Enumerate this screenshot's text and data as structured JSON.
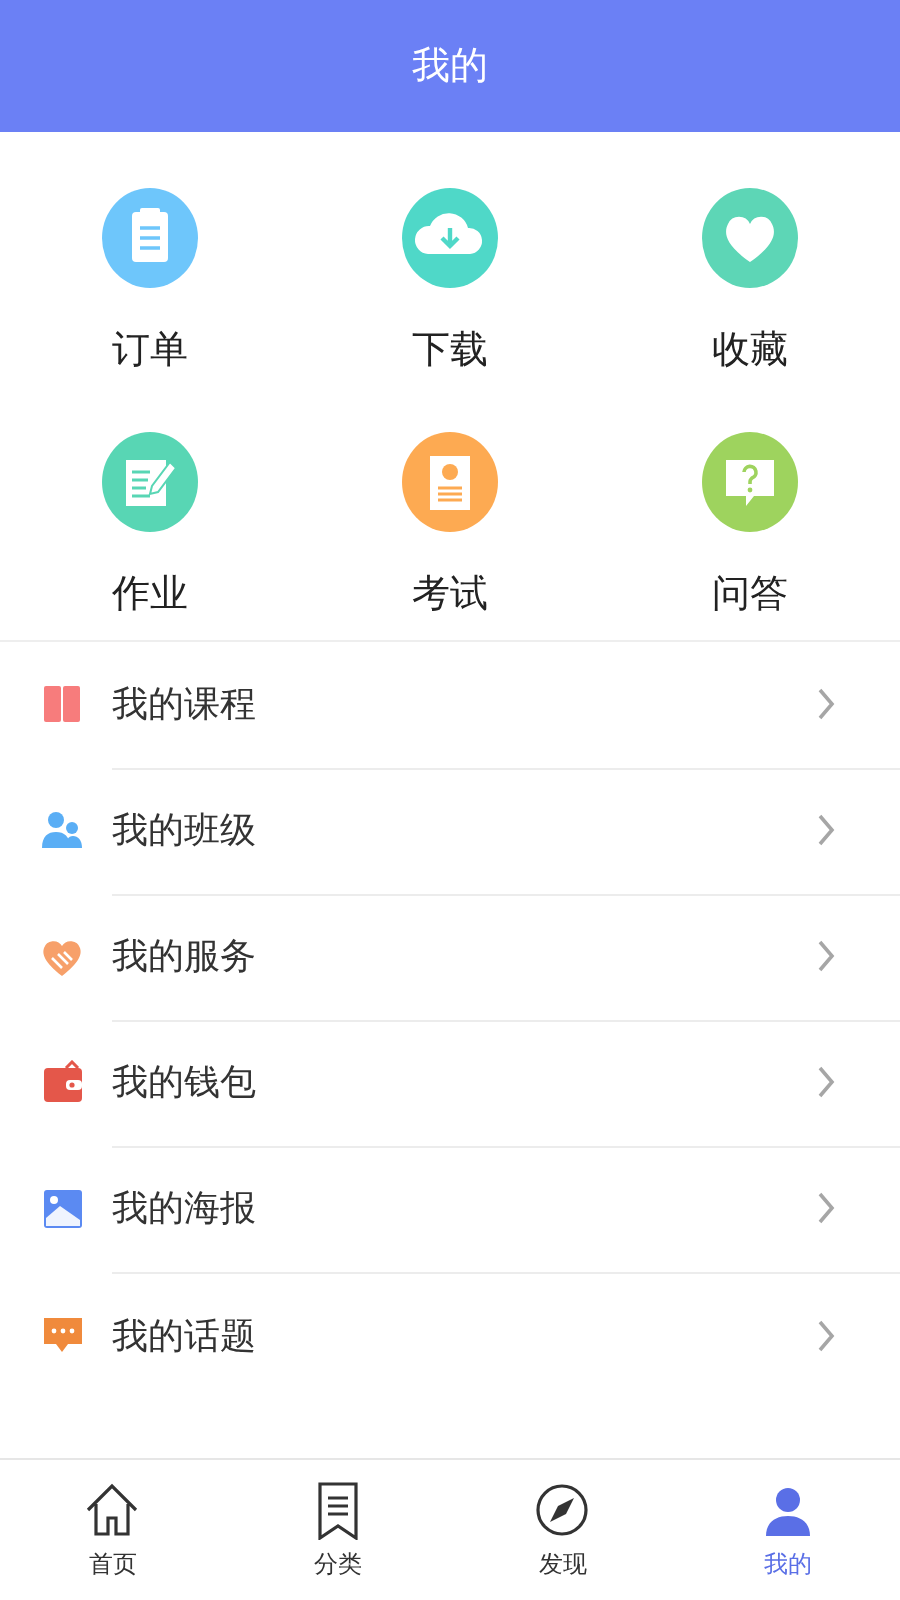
{
  "header": {
    "title": "我的"
  },
  "shortcuts": [
    {
      "label": "订单",
      "color": "#6ec6fb"
    },
    {
      "label": "下载",
      "color": "#4fd8c8"
    },
    {
      "label": "收藏",
      "color": "#5dd6b6"
    },
    {
      "label": "作业",
      "color": "#58d6b4"
    },
    {
      "label": "考试",
      "color": "#fdaa52"
    },
    {
      "label": "问答",
      "color": "#9ed35e"
    }
  ],
  "menu": [
    {
      "label": "我的课程"
    },
    {
      "label": "我的班级"
    },
    {
      "label": "我的服务"
    },
    {
      "label": "我的钱包"
    },
    {
      "label": "我的海报"
    },
    {
      "label": "我的话题"
    }
  ],
  "tabbar": [
    {
      "label": "首页",
      "selected": false
    },
    {
      "label": "分类",
      "selected": false
    },
    {
      "label": "发现",
      "selected": false
    },
    {
      "label": "我的",
      "selected": true
    }
  ]
}
